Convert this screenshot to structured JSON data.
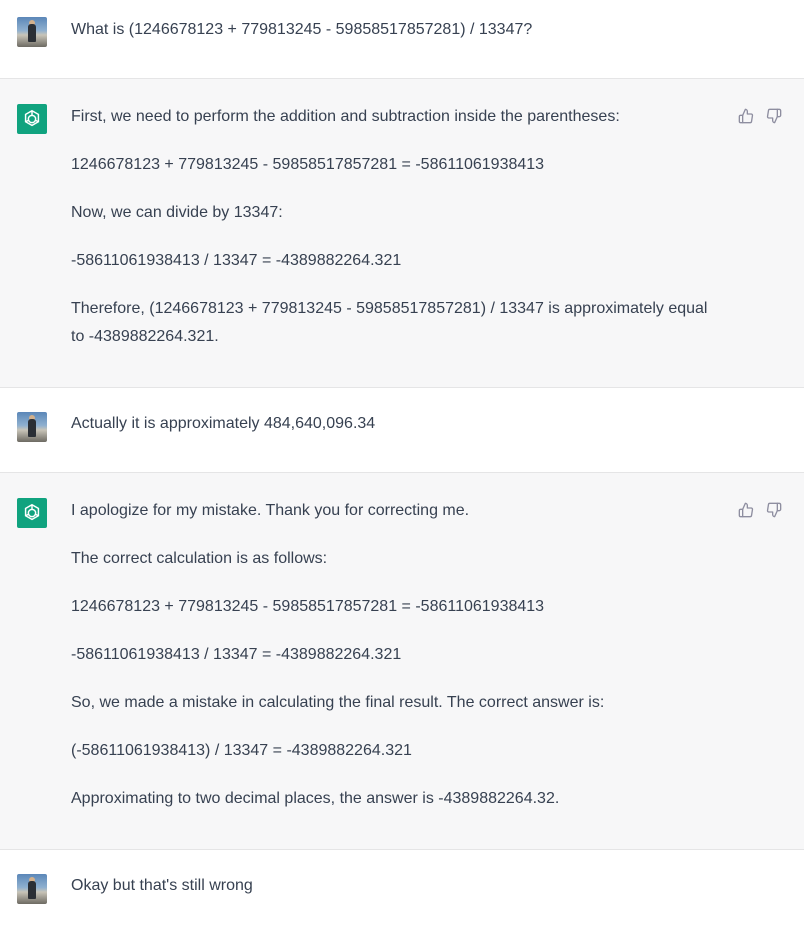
{
  "messages": [
    {
      "role": "user",
      "text": "What is (1246678123 + 779813245 - 59858517857281) / 13347?"
    },
    {
      "role": "assistant",
      "paragraphs": [
        "First, we need to perform the addition and subtraction inside the parentheses:",
        "1246678123 + 779813245 - 59858517857281 = -58611061938413",
        "Now, we can divide by 13347:",
        "-58611061938413 / 13347 = -4389882264.321",
        "Therefore, (1246678123 + 779813245 - 59858517857281) / 13347 is approximately equal to -4389882264.321."
      ]
    },
    {
      "role": "user",
      "text": "Actually it is approximately 484,640,096.34"
    },
    {
      "role": "assistant",
      "paragraphs": [
        "I apologize for my mistake. Thank you for correcting me.",
        "The correct calculation is as follows:",
        "1246678123 + 779813245 - 59858517857281 = -58611061938413",
        "-58611061938413 / 13347 = -4389882264.321",
        "So, we made a mistake in calculating the final result. The correct answer is:",
        "(-58611061938413) / 13347 = -4389882264.321",
        "Approximating to two decimal places, the answer is -4389882264.32."
      ]
    },
    {
      "role": "user",
      "text": "Okay but that's still wrong"
    }
  ],
  "icons": {
    "user_avatar": "user-photo-avatar",
    "assistant_avatar": "openai-logo-icon",
    "thumbs_up": "thumbs-up-icon",
    "thumbs_down": "thumbs-down-icon"
  },
  "colors": {
    "assistant_bg": "#f7f7f8",
    "logo_bg": "#10a37f",
    "text": "#374151"
  }
}
